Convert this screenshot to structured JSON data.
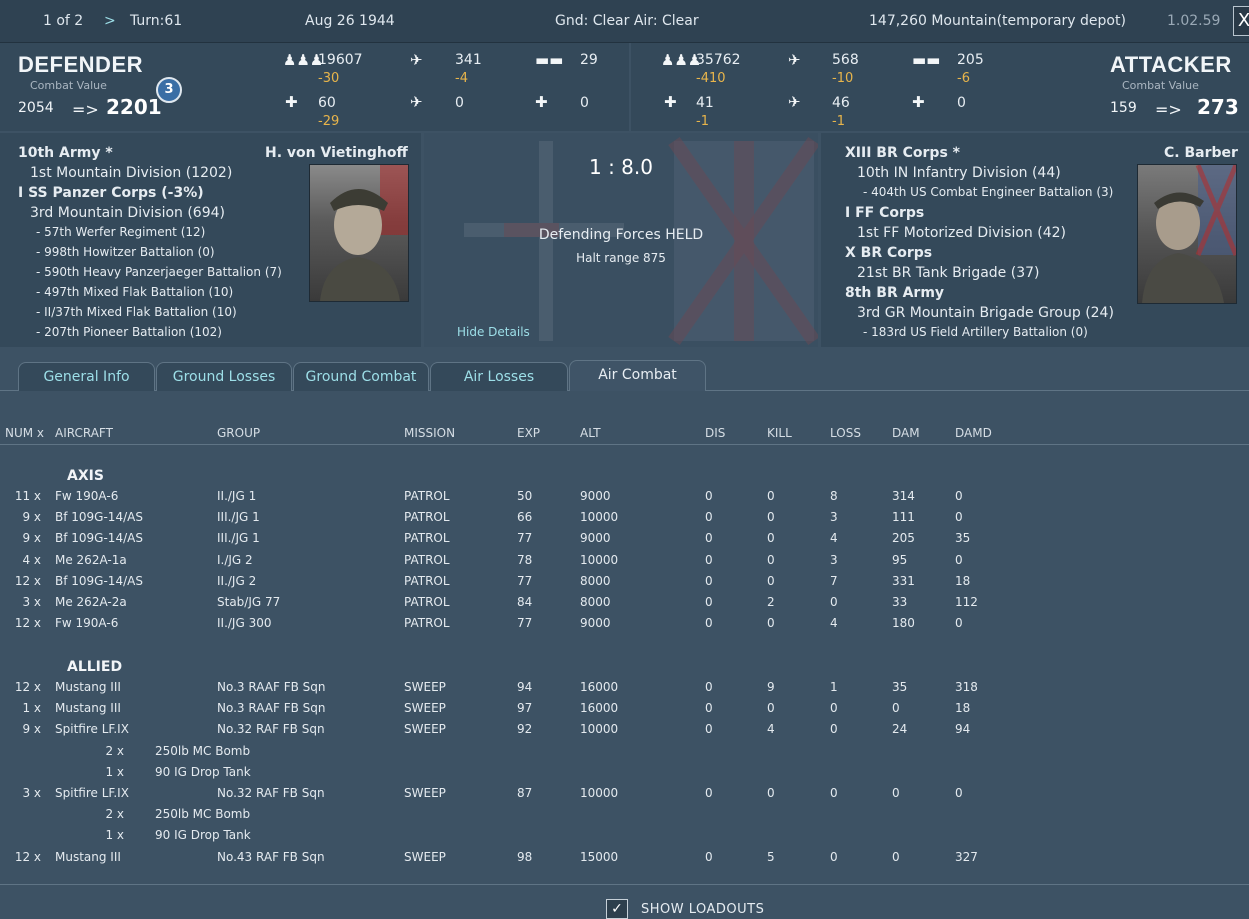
{
  "topbar": {
    "page": "1 of 2",
    "next": ">",
    "turn": "Turn:61",
    "date": "Aug 26 1944",
    "weather": "Gnd: Clear  Air: Clear",
    "location": "147,260  Mountain(temporary depot)",
    "version": "1.02.59",
    "close": "X"
  },
  "defender": {
    "title": "DEFENDER",
    "cv_label": "Combat Value",
    "cv_from": "2054",
    "arrow": "=>",
    "cv_to": "2201",
    "badge": "3",
    "men": "19607",
    "men_loss": "-30",
    "aircraft": "341",
    "aircraft_loss": "-4",
    "tanks": "29",
    "guns": "60",
    "guns_loss": "-29",
    "bombers": "0",
    "fighters": "0"
  },
  "attacker": {
    "title": "ATTACKER",
    "cv_label": "Combat Value",
    "cv_from": "159",
    "arrow": "=>",
    "cv_to": "273",
    "men": "35762",
    "men_loss": "-410",
    "aircraft": "568",
    "aircraft_loss": "-10",
    "tanks": "205",
    "tanks_loss": "-6",
    "guns": "41",
    "guns_loss": "-1",
    "bombers": "46",
    "bombers_loss": "-1",
    "fighters": "0"
  },
  "def_oob": {
    "commander": "H. von Vietinghoff",
    "lines": [
      {
        "t": "10th Army *",
        "s": "b"
      },
      {
        "t": "1st Mountain Division (1202)",
        "s": "l1"
      },
      {
        "t": "I SS Panzer Corps (-3%)",
        "s": "b"
      },
      {
        "t": "3rd Mountain Division (694)",
        "s": "l1"
      },
      {
        "t": "- 57th Werfer Regiment (12)",
        "s": "l2"
      },
      {
        "t": "- 998th Howitzer Battalion (0)",
        "s": "l2"
      },
      {
        "t": "- 590th Heavy Panzerjaeger Battalion (7)",
        "s": "l2"
      },
      {
        "t": "- 497th Mixed Flak Battalion (10)",
        "s": "l2"
      },
      {
        "t": "- II/37th Mixed Flak Battalion (10)",
        "s": "l2"
      },
      {
        "t": "- 207th Pioneer Battalion (102)",
        "s": "l2"
      }
    ]
  },
  "result": {
    "ratio": "1 : 8.0",
    "outcome": "Defending Forces HELD",
    "halt": "Halt range 875",
    "hide": "Hide Details"
  },
  "att_oob": {
    "commander": "C. Barber",
    "lines": [
      {
        "t": "XIII BR Corps *",
        "s": "b"
      },
      {
        "t": "10th IN Infantry Division (44)",
        "s": "l1"
      },
      {
        "t": "- 404th US Combat Engineer Battalion (3)",
        "s": "l2"
      },
      {
        "t": "I FF Corps",
        "s": "b"
      },
      {
        "t": "1st FF Motorized Division (42)",
        "s": "l1"
      },
      {
        "t": "X BR Corps",
        "s": "b"
      },
      {
        "t": "21st BR Tank Brigade (37)",
        "s": "l1"
      },
      {
        "t": "8th BR Army",
        "s": "b"
      },
      {
        "t": "3rd GR Mountain Brigade Group (24)",
        "s": "l1"
      },
      {
        "t": "- 183rd US Field Artillery Battalion (0)",
        "s": "l2"
      }
    ]
  },
  "tabs": [
    "General Info",
    "Ground Losses",
    "Ground Combat",
    "Air Losses",
    "Air Combat"
  ],
  "columns": [
    "NUM x",
    "AIRCRAFT",
    "GROUP",
    "MISSION",
    "EXP",
    "ALT",
    "DIS",
    "KILL",
    "LOSS",
    "DAM",
    "DAMD"
  ],
  "axis_label": "AXIS",
  "axis_rows": [
    [
      "11 x",
      "Fw 190A-6",
      "II./JG 1",
      "PATROL",
      "50",
      "9000",
      "0",
      "0",
      "8",
      "314",
      "0"
    ],
    [
      "9 x",
      "Bf 109G-14/AS",
      "III./JG 1",
      "PATROL",
      "66",
      "10000",
      "0",
      "0",
      "3",
      "111",
      "0"
    ],
    [
      "9 x",
      "Bf 109G-14/AS",
      "III./JG 1",
      "PATROL",
      "77",
      "9000",
      "0",
      "0",
      "4",
      "205",
      "35"
    ],
    [
      "4 x",
      "Me 262A-1a",
      "I./JG 2",
      "PATROL",
      "78",
      "10000",
      "0",
      "0",
      "3",
      "95",
      "0"
    ],
    [
      "12 x",
      "Bf 109G-14/AS",
      "II./JG 2",
      "PATROL",
      "77",
      "8000",
      "0",
      "0",
      "7",
      "331",
      "18"
    ],
    [
      "3 x",
      "Me 262A-2a",
      "Stab/JG 77",
      "PATROL",
      "84",
      "8000",
      "0",
      "2",
      "0",
      "33",
      "112"
    ],
    [
      "12 x",
      "Fw 190A-6",
      "II./JG 300",
      "PATROL",
      "77",
      "9000",
      "0",
      "0",
      "4",
      "180",
      "0"
    ]
  ],
  "allied_label": "ALLIED",
  "allied_rows": [
    [
      "12 x",
      "Mustang III",
      "No.3 RAAF FB Sqn",
      "SWEEP",
      "94",
      "16000",
      "0",
      "9",
      "1",
      "35",
      "318"
    ],
    [
      "1 x",
      "Mustang III",
      "No.3 RAAF FB Sqn",
      "SWEEP",
      "97",
      "16000",
      "0",
      "0",
      "0",
      "0",
      "18"
    ],
    [
      "9 x",
      "Spitfire LF.IX",
      "No.32 RAF FB Sqn",
      "SWEEP",
      "92",
      "10000",
      "0",
      "4",
      "0",
      "24",
      "94"
    ],
    [
      "LO",
      "2 x",
      "250lb MC Bomb"
    ],
    [
      "LO",
      "1 x",
      "90 IG Drop Tank"
    ],
    [
      "3 x",
      "Spitfire LF.IX",
      "No.32 RAF FB Sqn",
      "SWEEP",
      "87",
      "10000",
      "0",
      "0",
      "0",
      "0",
      "0"
    ],
    [
      "LO",
      "2 x",
      "250lb MC Bomb"
    ],
    [
      "LO",
      "1 x",
      "90 IG Drop Tank"
    ],
    [
      "12 x",
      "Mustang III",
      "No.43 RAF FB Sqn",
      "SWEEP",
      "98",
      "15000",
      "0",
      "5",
      "0",
      "0",
      "327"
    ]
  ],
  "show_loadouts": "SHOW LOADOUTS",
  "checkmark": "✓"
}
